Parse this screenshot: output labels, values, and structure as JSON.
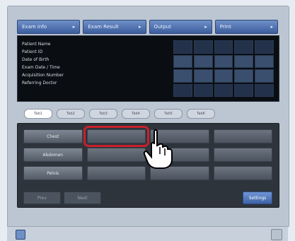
{
  "header": {
    "tabs": [
      {
        "label": "Exam info",
        "arrow": "▸"
      },
      {
        "label": "Exam Result",
        "arrow": "▸"
      },
      {
        "label": "Output",
        "arrow": "▸"
      },
      {
        "label": "Print",
        "arrow": "▸"
      }
    ]
  },
  "info": {
    "lines": [
      "Patient Name",
      "Patient ID",
      "Date of Birth",
      "Exam Date / Time",
      "Acquisition Number",
      "Referring Doctor"
    ]
  },
  "lower": {
    "subtabs": [
      "Tab1",
      "Tab2",
      "Tab3",
      "Tab4",
      "Tab5",
      "Tab6"
    ],
    "buttons": {
      "row1": [
        "Chest",
        "",
        "",
        ""
      ],
      "row2": [
        "Abdomen",
        "",
        "",
        ""
      ],
      "row3": [
        "Pelvis",
        "",
        "",
        ""
      ]
    },
    "bottom_left": [
      "Prev",
      "Next"
    ],
    "bottom_right": "Settings"
  },
  "colors": {
    "highlight": "#c8202b"
  },
  "icons": {
    "pointer": "hand-pointer-icon"
  }
}
